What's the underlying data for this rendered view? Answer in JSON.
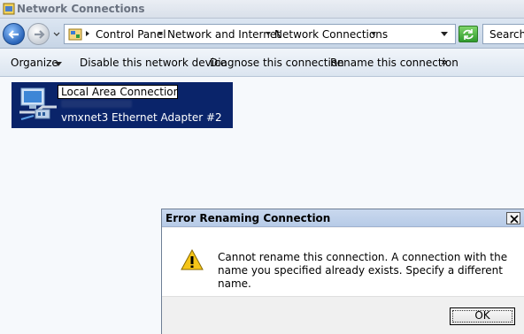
{
  "window": {
    "title": "Network Connections"
  },
  "address": {
    "crumbs": [
      "Control Panel",
      "Network and Internet",
      "Network Connections"
    ],
    "search_placeholder": "Search N"
  },
  "toolbar": {
    "organize": "Organize",
    "disable": "Disable this network device",
    "diagnose": "Diagnose this connection",
    "rename": "Rename this connection",
    "more": "»"
  },
  "connection": {
    "name_edit_value": "Local Area Connection",
    "adapter": "vmxnet3 Ethernet Adapter #2"
  },
  "dialog": {
    "title": "Error Renaming Connection",
    "message": "Cannot rename this connection. A connection with the name you specified already exists. Specify a different name.",
    "ok_label": "OK"
  },
  "icons": [
    "network-connections-app-icon",
    "back-arrow-icon",
    "forward-arrow-icon",
    "control-panel-icon",
    "refresh-icon",
    "network-adapter-icon",
    "warning-icon",
    "close-icon"
  ]
}
